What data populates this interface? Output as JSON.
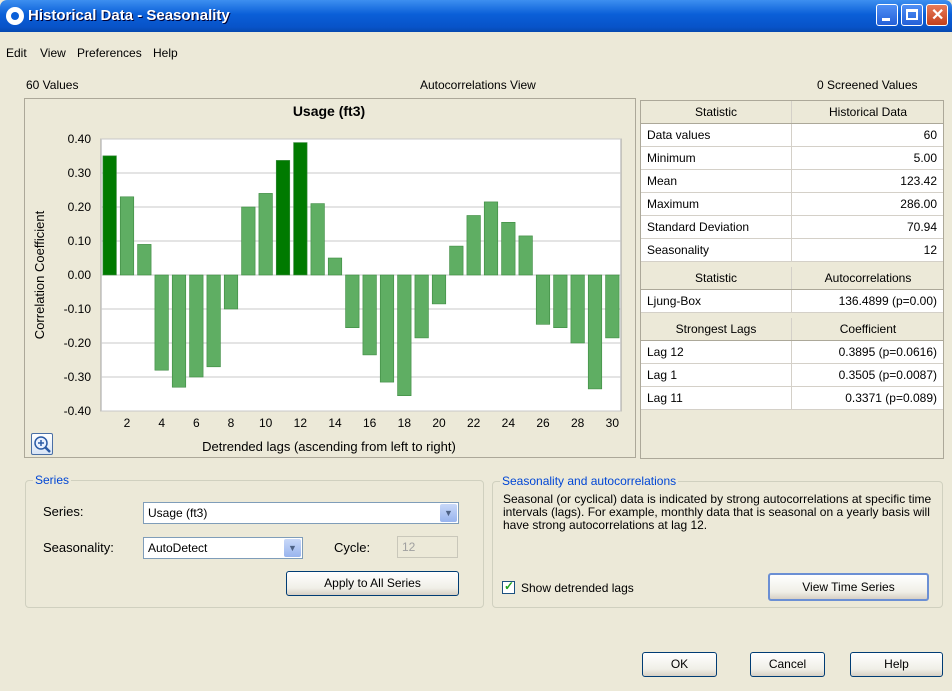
{
  "window": {
    "title": "Historical Data - Seasonality"
  },
  "menu": [
    "Edit",
    "View",
    "Preferences",
    "Help"
  ],
  "top_labels": {
    "values_count": "60 Values",
    "view_name": "Autocorrelations View",
    "screened": "0 Screened Values"
  },
  "chart_data": {
    "type": "bar",
    "title": "Usage (ft3)",
    "xlabel": "Detrended lags (ascending from left to right)",
    "ylabel": "Correlation Coefficient",
    "ylim": [
      -0.4,
      0.4
    ],
    "yticks": [
      "0.40",
      "0.30",
      "0.20",
      "0.10",
      "0.00",
      "-0.10",
      "-0.20",
      "-0.30",
      "-0.40"
    ],
    "xticks": [
      "2",
      "4",
      "6",
      "8",
      "10",
      "12",
      "14",
      "16",
      "18",
      "20",
      "22",
      "24",
      "26",
      "28",
      "30"
    ],
    "x": [
      1,
      2,
      3,
      4,
      5,
      6,
      7,
      8,
      9,
      10,
      11,
      12,
      13,
      14,
      15,
      16,
      17,
      18,
      19,
      20,
      21,
      22,
      23,
      24,
      25,
      26,
      27,
      28,
      29,
      30
    ],
    "values": [
      0.3505,
      0.23,
      0.09,
      -0.28,
      -0.33,
      -0.3,
      -0.27,
      -0.1,
      0.2,
      0.24,
      0.3371,
      0.3895,
      0.21,
      0.05,
      -0.155,
      -0.235,
      -0.315,
      -0.355,
      -0.185,
      -0.085,
      0.085,
      0.175,
      0.215,
      0.155,
      0.115,
      -0.145,
      -0.155,
      -0.2,
      -0.335,
      -0.185
    ],
    "highlighted_lags": [
      1,
      11,
      12
    ],
    "colors": {
      "normal": "#5fae63",
      "highlight": "#007a00",
      "border": "#3c8a40"
    }
  },
  "stats_table": {
    "basic_header": [
      "Statistic",
      "Historical Data"
    ],
    "basic_rows": [
      [
        "Data values",
        "60"
      ],
      [
        "Minimum",
        "5.00"
      ],
      [
        "Mean",
        "123.42"
      ],
      [
        "Maximum",
        "286.00"
      ],
      [
        "Standard Deviation",
        "70.94"
      ],
      [
        "Seasonality",
        "12"
      ]
    ],
    "auto_header": [
      "Statistic",
      "Autocorrelations"
    ],
    "auto_rows": [
      [
        "Ljung-Box",
        "136.4899 (p=0.00)"
      ]
    ],
    "lags_header": [
      "Strongest Lags",
      "Coefficient"
    ],
    "lags_rows": [
      [
        "Lag 12",
        "0.3895 (p=0.0616)"
      ],
      [
        "Lag 1",
        "0.3505 (p=0.0087)"
      ],
      [
        "Lag 11",
        "0.3371 (p=0.089)"
      ]
    ]
  },
  "series_group": {
    "title": "Series",
    "series_label": "Series:",
    "series_value": "Usage (ft3)",
    "seasonality_label": "Seasonality:",
    "seasonality_value": "AutoDetect",
    "cycle_label": "Cycle:",
    "cycle_value": "12",
    "apply_button": "Apply to All Series"
  },
  "season_group": {
    "title": "Seasonality and autocorrelations",
    "description": "Seasonal (or cyclical) data is indicated by strong autocorrelations at specific time intervals (lags).  For example, monthly data that is seasonal on a yearly basis will have strong autocorrelations at lag 12.",
    "checkbox_label": "Show detrended lags",
    "checkbox_checked": true,
    "view_button": "View Time Series"
  },
  "footer": {
    "ok": "OK",
    "cancel": "Cancel",
    "help": "Help"
  }
}
